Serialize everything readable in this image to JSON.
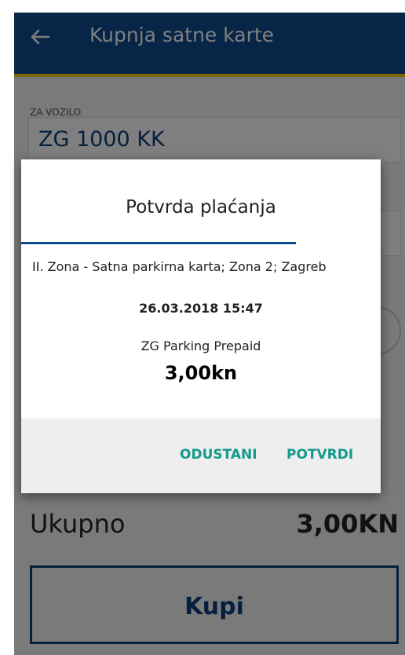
{
  "header": {
    "title": "Kupnja satne karte",
    "back_icon": "arrow-left-icon"
  },
  "vehicle": {
    "label": "ZA VOZILO",
    "value": "ZG 1000 KK"
  },
  "summary": {
    "total_label": "Ukupno",
    "total_value": "3,00KN"
  },
  "buy_button": {
    "label": "Kupi"
  },
  "dialog": {
    "title": "Potvrda plaćanja",
    "description": "II. Zona - Satna parkirna karta; Zona 2; Zagreb",
    "datetime": "26.03.2018 15:47",
    "provider": "ZG Parking Prepaid",
    "amount": "3,00kn",
    "cancel_label": "ODUSTANI",
    "confirm_label": "POTVRDI"
  },
  "colors": {
    "primary": "#0d4a8f",
    "accent": "#ffcc00",
    "action": "#14998c"
  }
}
